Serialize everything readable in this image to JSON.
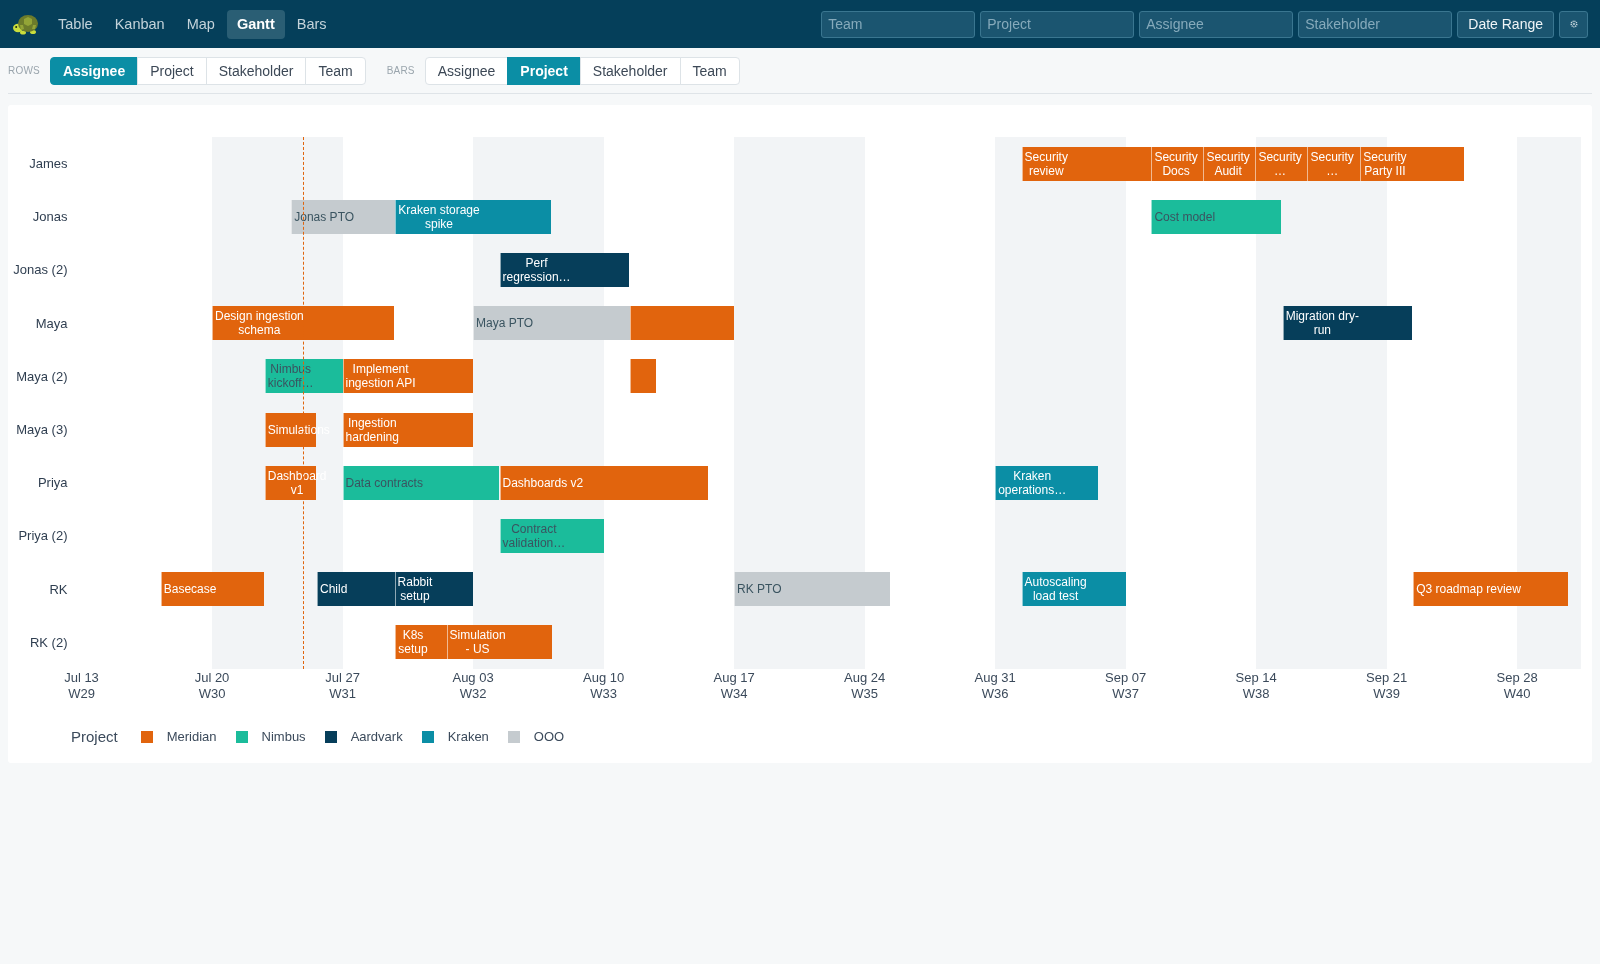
{
  "nav": [
    {
      "label": "Table",
      "selected": false
    },
    {
      "label": "Kanban",
      "selected": false
    },
    {
      "label": "Map",
      "selected": false
    },
    {
      "label": "Gantt",
      "selected": true
    },
    {
      "label": "Bars",
      "selected": false
    }
  ],
  "filters": [
    {
      "placeholder": "Team"
    },
    {
      "placeholder": "Project"
    },
    {
      "placeholder": "Assignee"
    },
    {
      "placeholder": "Stakeholder"
    }
  ],
  "date_range_button": {
    "label": "Date Range"
  },
  "grouping": [
    {
      "label": "ROWS",
      "options": [
        {
          "label": "Assignee",
          "selected": true
        },
        {
          "label": "Project",
          "selected": false
        },
        {
          "label": "Stakeholder",
          "selected": false
        },
        {
          "label": "Team",
          "selected": false
        }
      ]
    },
    {
      "label": "BARS",
      "options": [
        {
          "label": "Assignee",
          "selected": false
        },
        {
          "label": "Project",
          "selected": true
        },
        {
          "label": "Stakeholder",
          "selected": false
        },
        {
          "label": "Team",
          "selected": false
        }
      ]
    }
  ],
  "gantt": {
    "rows": [
      {
        "label": "James",
        "bars": [
          {
            "text": "Security\nreview",
            "color": "#e1640d"
          },
          {
            "text": "Security\nDocs",
            "color": "#e1640d"
          },
          {
            "text": "Security\nAudit",
            "color": "#e1640d"
          },
          {
            "text": "Security\n…",
            "color": "#e1640d"
          },
          {
            "text": "Security\n…",
            "color": "#e1640d"
          },
          {
            "text": "Security\nParty III",
            "color": "#e1640d"
          }
        ]
      },
      {
        "label": "Jonas",
        "bars": [
          {
            "text": "Jonas PTO",
            "color": "#c5cbcf"
          },
          {
            "text": "Kraken storage\nspike",
            "color": "#0b8ea5"
          },
          {
            "text": "Cost model",
            "color": "#1bbc9b"
          }
        ]
      },
      {
        "label": "Jonas (2)",
        "bars": [
          {
            "text": "Perf\nregression…",
            "color": "#063e5a"
          }
        ]
      },
      {
        "label": "Maya",
        "bars": [
          {
            "text": "Design ingestion\nschema",
            "color": "#e1640d"
          },
          {
            "text": "Maya PTO",
            "color": "#c5cbcf"
          },
          {
            "color": "#e1640d"
          },
          {
            "text": "Migration dry-\nrun",
            "color": "#063e5a"
          }
        ]
      },
      {
        "label": "Maya (2)",
        "bars": [
          {
            "text": "Nimbus\nkickoff…",
            "color": "#1bbc9b"
          },
          {
            "text": "Implement\ningestion API",
            "color": "#e1640d"
          },
          {
            "color": "#e1640d"
          }
        ]
      },
      {
        "label": "Maya (3)",
        "bars": [
          {
            "text": "Simulations",
            "color": "#e1640d"
          },
          {
            "text": "Ingestion\nhardening",
            "color": "#e1640d"
          }
        ]
      },
      {
        "label": "Priya",
        "bars": [
          {
            "text": "Dashboard\nv1",
            "color": "#e1640d"
          },
          {
            "text": "Data contracts",
            "color": "#1bbc9b"
          },
          {
            "text": "Dashboards v2",
            "color": "#e1640d"
          },
          {
            "text": "Kraken\noperations…",
            "color": "#0b8ea5"
          }
        ]
      },
      {
        "label": "Priya (2)",
        "bars": [
          {
            "text": "Contract\nvalidation…",
            "color": "#1bbc9b"
          }
        ]
      },
      {
        "label": "RK",
        "bars": [
          {
            "text": "Basecase",
            "color": "#e1640d"
          },
          {
            "text": "Child",
            "color": "#063e5a"
          },
          {
            "text": "Rabbit\nsetup",
            "color": "#063e5a"
          },
          {
            "text": "RK PTO",
            "color": "#c5cbcf"
          },
          {
            "text": "Autoscaling\nload test",
            "color": "#0b8ea5"
          },
          {
            "text": "Q3 roadmap review",
            "color": "#e1640d"
          }
        ]
      },
      {
        "label": "RK (2)",
        "bars": [
          {
            "text": "K8s\nsetup",
            "color": "#e1640d"
          },
          {
            "text": "Simulation\n- US",
            "color": "#e1640d"
          }
        ]
      }
    ],
    "axis": [
      {
        "date": "Jul 13",
        "week": "W29"
      },
      {
        "date": "Jul 20",
        "week": "W30"
      },
      {
        "date": "Jul 27",
        "week": "W31"
      },
      {
        "date": "Aug 03",
        "week": "W32"
      },
      {
        "date": "Aug 10",
        "week": "W33"
      },
      {
        "date": "Aug 17",
        "week": "W34"
      },
      {
        "date": "Aug 24",
        "week": "W35"
      },
      {
        "date": "Aug 31",
        "week": "W36"
      },
      {
        "date": "Sep 07",
        "week": "W37"
      },
      {
        "date": "Sep 14",
        "week": "W38"
      },
      {
        "date": "Sep 21",
        "week": "W39"
      },
      {
        "date": "Sep 28",
        "week": "W40"
      }
    ],
    "legend": {
      "title": "Project",
      "items": [
        {
          "label": "Meridian",
          "color": "#e1640d"
        },
        {
          "label": "Nimbus",
          "color": "#1bbc9b"
        },
        {
          "label": "Aardvark",
          "color": "#063e5a"
        },
        {
          "label": "Kraken",
          "color": "#0b8ea5"
        },
        {
          "label": "OOO",
          "color": "#c5cbcf"
        }
      ]
    }
  }
}
